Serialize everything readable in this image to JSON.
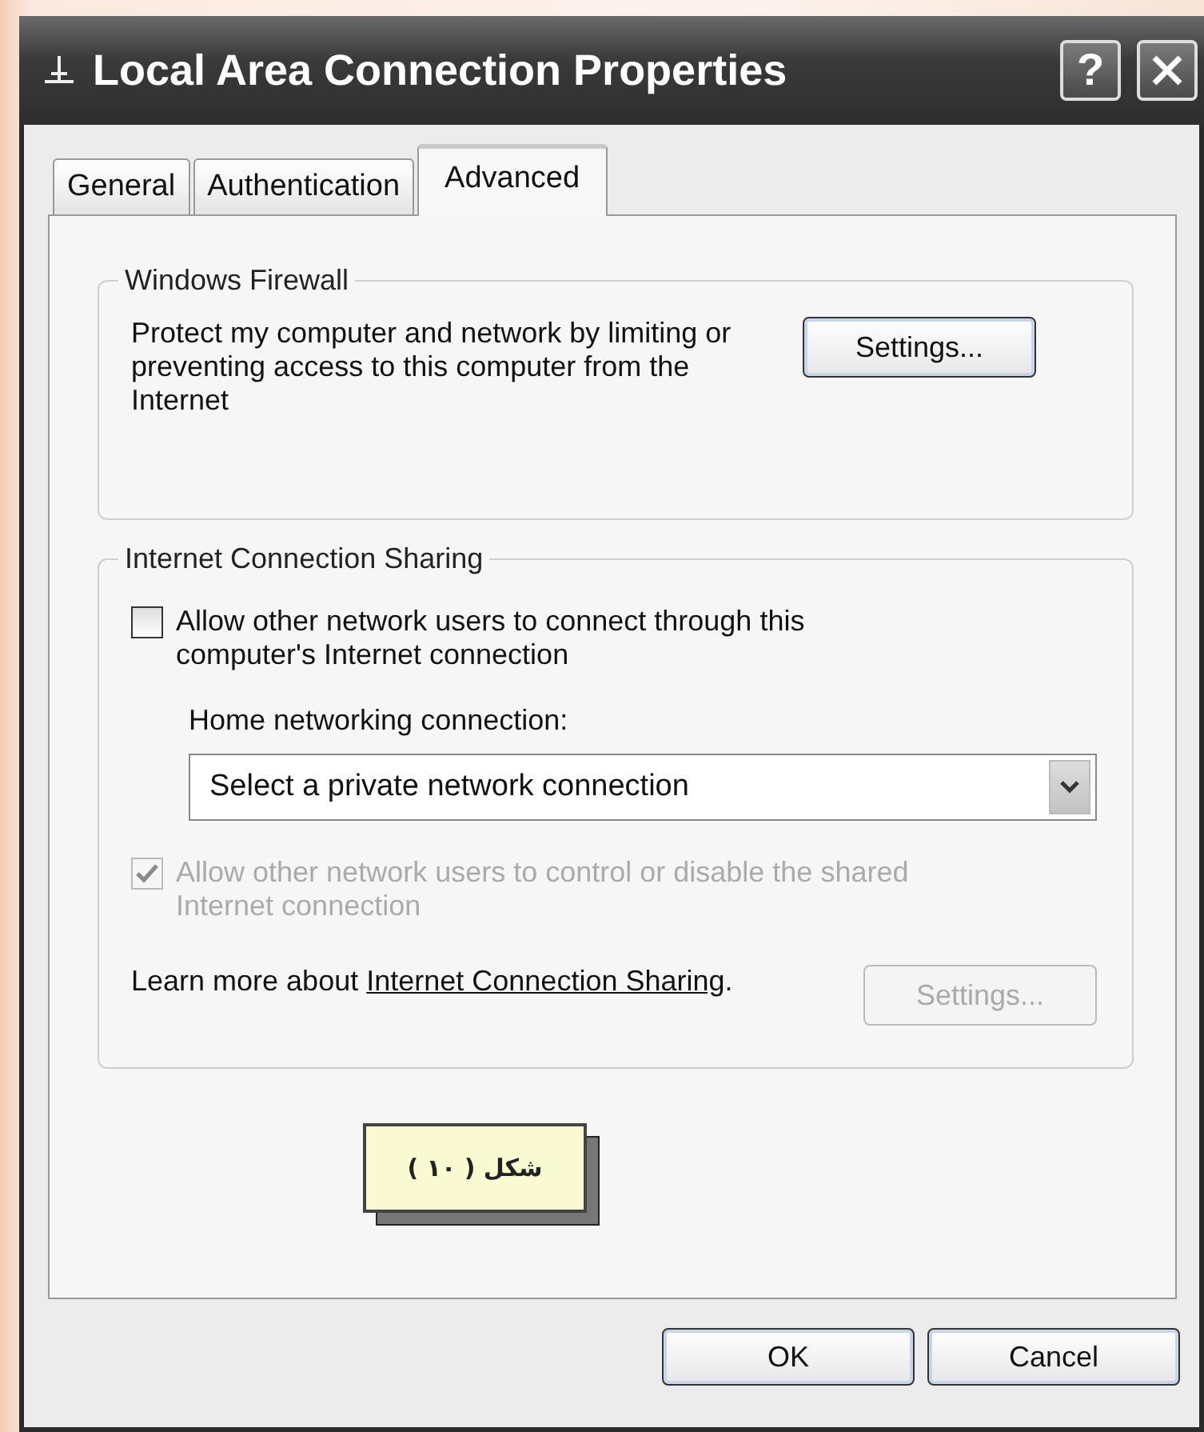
{
  "window": {
    "title": "Local Area Connection Properties",
    "help_button": "?"
  },
  "tabs": [
    {
      "label": "General",
      "selected": false
    },
    {
      "label": "Authentication",
      "selected": false
    },
    {
      "label": "Advanced",
      "selected": true
    }
  ],
  "firewall": {
    "title": "Windows Firewall",
    "description": "Protect my computer and network by limiting or preventing access to this computer from the Internet",
    "button": {
      "label": "Settings...",
      "disabled": false
    }
  },
  "sharing": {
    "title": "Internet Connection Sharing",
    "options": [
      {
        "label": "Allow other network users to connect through this computer's Internet connection",
        "checked": false,
        "disabled": false
      },
      {
        "label": "Allow other network users to control or disable the shared Internet connection",
        "checked": true,
        "disabled": true
      }
    ],
    "home_label": "Home networking connection:",
    "dropdown": {
      "value": "Select a private network connection"
    },
    "learn_more": {
      "text": "Learn more about",
      "link": "Internet Connection Sharing",
      "suffix": "."
    },
    "button": {
      "label": "Settings...",
      "disabled": true
    }
  },
  "caption": "شكل ( ١٠ )",
  "buttons": [
    {
      "label": "OK"
    },
    {
      "label": "Cancel"
    }
  ]
}
